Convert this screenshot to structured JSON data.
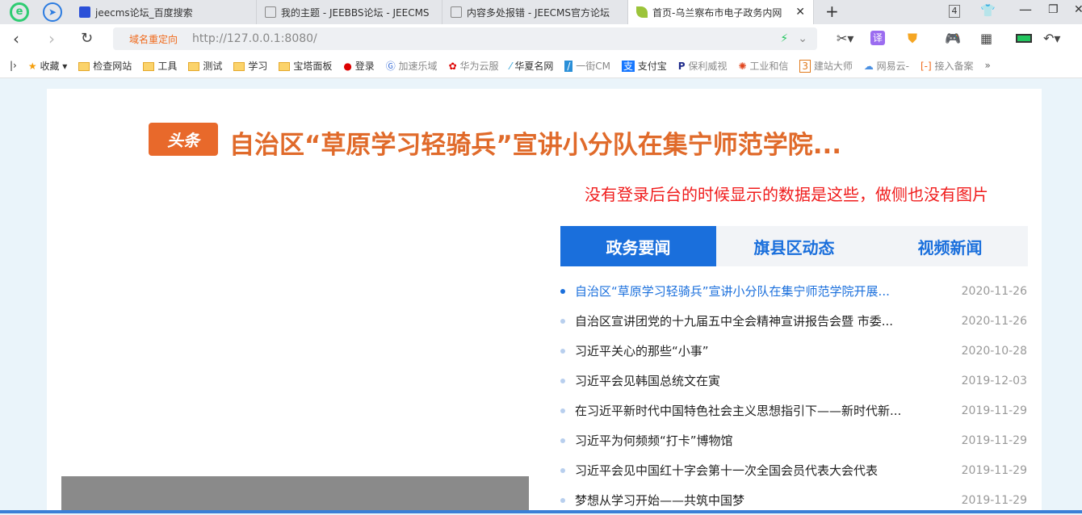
{
  "browser": {
    "tabs": [
      {
        "label": "jeecms论坛_百度搜索"
      },
      {
        "label": "我的主题 - JEEBBS论坛 - JEECMS"
      },
      {
        "label": "内容多处报错 - JEECMS官方论坛"
      },
      {
        "label": "首页-乌兰察布市电子政务内网"
      }
    ],
    "tab_count": "4",
    "redirect_label": "域名重定向",
    "url": "http://127.0.0.1:8080/",
    "bookmarks": [
      "收藏",
      "检查网站",
      "工具",
      "测试",
      "学习",
      "宝塔面板",
      "登录",
      "加速乐域",
      "华为云服",
      "华夏名网",
      "一街CM",
      "支付宝",
      "保利威视",
      "工业和信",
      "建站大师",
      "网易云-",
      "接入备案"
    ],
    "more": "»"
  },
  "page": {
    "badge": "头条",
    "headline": "自治区“草原学习轻骑兵”宣讲小分队在集宁师范学院...",
    "note": "没有登录后台的时候显示的数据是这些，做侧也没有图片",
    "news_tabs": [
      {
        "label": "政务要闻"
      },
      {
        "label": "旗县区动态"
      },
      {
        "label": "视频新闻"
      }
    ],
    "news": [
      {
        "title": "自治区“草原学习轻骑兵”宣讲小分队在集宁师范学院开展...",
        "date": "2020-11-26"
      },
      {
        "title": "自治区宣讲团党的十九届五中全会精神宣讲报告会暨 市委...",
        "date": "2020-11-26"
      },
      {
        "title": "习近平关心的那些“小事”",
        "date": "2020-10-28"
      },
      {
        "title": "习近平会见韩国总统文在寅",
        "date": "2019-12-03"
      },
      {
        "title": "在习近平新时代中国特色社会主义思想指引下——新时代新...",
        "date": "2019-11-29"
      },
      {
        "title": "习近平为何频频“打卡”博物馆",
        "date": "2019-11-29"
      },
      {
        "title": "习近平会见中国红十字会第十一次全国会员代表大会代表",
        "date": "2019-11-29"
      },
      {
        "title": "梦想从学习开始——共筑中国梦",
        "date": "2019-11-29"
      }
    ]
  }
}
